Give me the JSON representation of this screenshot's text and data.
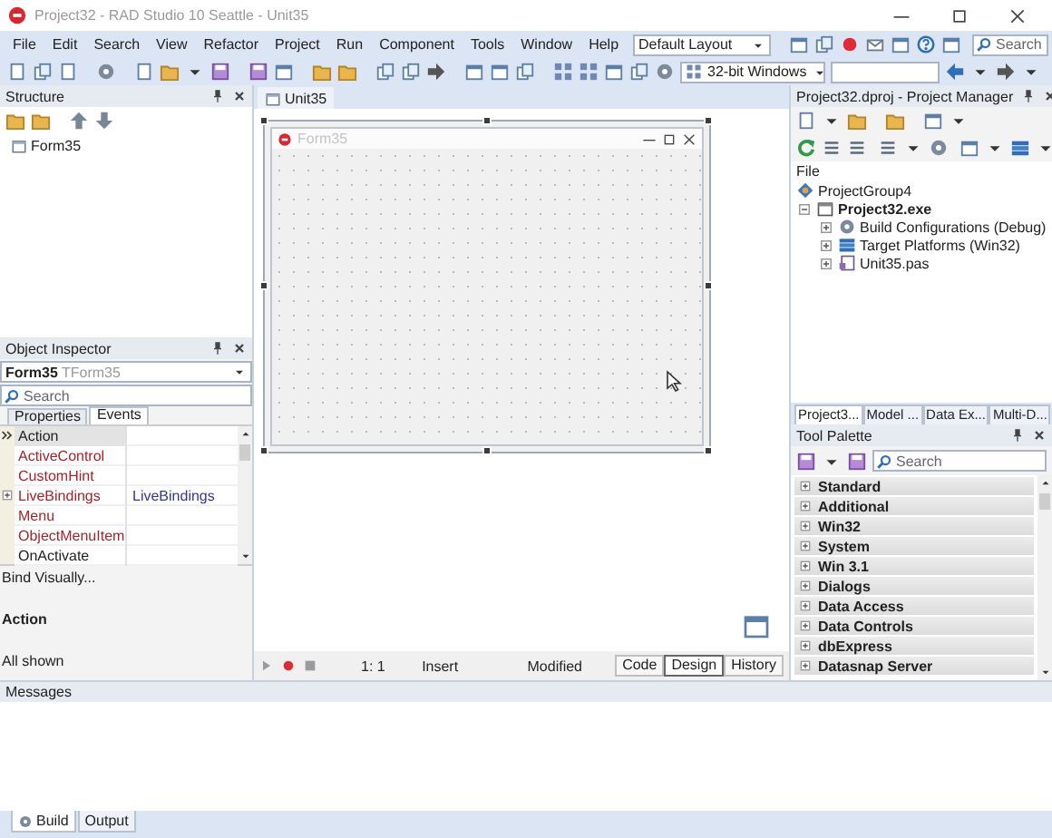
{
  "window": {
    "title": "Project32 - RAD Studio 10 Seattle - Unit35"
  },
  "menu": [
    "File",
    "Edit",
    "Search",
    "View",
    "Refactor",
    "Project",
    "Run",
    "Component",
    "Tools",
    "Window",
    "Help"
  ],
  "layout_combo": {
    "value": "Default Layout"
  },
  "ide_search": {
    "placeholder": "Search"
  },
  "platform_combo": {
    "value": "32-bit Windows"
  },
  "structure": {
    "title": "Structure",
    "items": [
      {
        "label": "Form35"
      }
    ]
  },
  "object_inspector": {
    "title": "Object Inspector",
    "object": "Form35",
    "object_class": "TForm35",
    "search": {
      "placeholder": "Search"
    },
    "tabs": [
      {
        "label": "Properties",
        "selected": false
      },
      {
        "label": "Events",
        "selected": true
      }
    ],
    "rows": [
      {
        "name": "Action",
        "kind": "plain",
        "selected": true
      },
      {
        "name": "ActiveControl",
        "kind": "linked",
        "selected": false
      },
      {
        "name": "CustomHint",
        "kind": "linked",
        "selected": false
      },
      {
        "name": "LiveBindings",
        "kind": "group",
        "value": "LiveBindings",
        "selected": false
      },
      {
        "name": "Menu",
        "kind": "linked",
        "selected": false
      },
      {
        "name": "ObjectMenuItem",
        "kind": "linked",
        "selected": false
      },
      {
        "name": "OnActivate",
        "kind": "plain",
        "selected": false
      }
    ],
    "bind_link": "Bind Visually...",
    "description_title": "Action",
    "filter_status": "All shown"
  },
  "editor": {
    "tabs": [
      {
        "label": "Unit35",
        "selected": true
      }
    ],
    "form": {
      "title": "Form35"
    },
    "status": {
      "position": "1: 1",
      "mode": "Insert",
      "state": "Modified"
    },
    "view_tabs": [
      {
        "label": "Code",
        "selected": false
      },
      {
        "label": "Design",
        "selected": true
      },
      {
        "label": "History",
        "selected": false
      }
    ]
  },
  "project_manager": {
    "title": "Project32.dproj - Project Manager",
    "column": "File",
    "tree": [
      {
        "label": "ProjectGroup4",
        "kind": "group",
        "children": [
          {
            "label": "Project32.exe",
            "kind": "project",
            "active": true,
            "expanded": true,
            "children": [
              {
                "label": "Build Configurations (Debug)",
                "kind": "config",
                "active": false,
                "expanded": false
              },
              {
                "label": "Target Platforms (Win32)",
                "kind": "platform",
                "active": false,
                "expanded": false
              },
              {
                "label": "Unit35.pas",
                "kind": "unit",
                "active": false,
                "expanded": false
              }
            ]
          }
        ]
      }
    ]
  },
  "right_tabs": [
    {
      "label": "Project3...",
      "selected": true
    },
    {
      "label": "Model ...",
      "selected": false
    },
    {
      "label": "Data Ex...",
      "selected": false
    },
    {
      "label": "Multi-D...",
      "selected": false
    }
  ],
  "tool_palette": {
    "title": "Tool Palette",
    "search": {
      "placeholder": "Search"
    },
    "categories": [
      {
        "label": "Standard",
        "expanded": false
      },
      {
        "label": "Additional",
        "expanded": false
      },
      {
        "label": "Win32",
        "expanded": false
      },
      {
        "label": "System",
        "expanded": false
      },
      {
        "label": "Win 3.1",
        "expanded": false
      },
      {
        "label": "Dialogs",
        "expanded": false
      },
      {
        "label": "Data Access",
        "expanded": false
      },
      {
        "label": "Data Controls",
        "expanded": false
      },
      {
        "label": "dbExpress",
        "expanded": false
      },
      {
        "label": "Datasnap Server",
        "expanded": false
      }
    ]
  },
  "messages": {
    "title": "Messages"
  },
  "bottom_tabs": [
    {
      "label": "Build",
      "selected": true
    },
    {
      "label": "Output",
      "selected": false
    }
  ]
}
